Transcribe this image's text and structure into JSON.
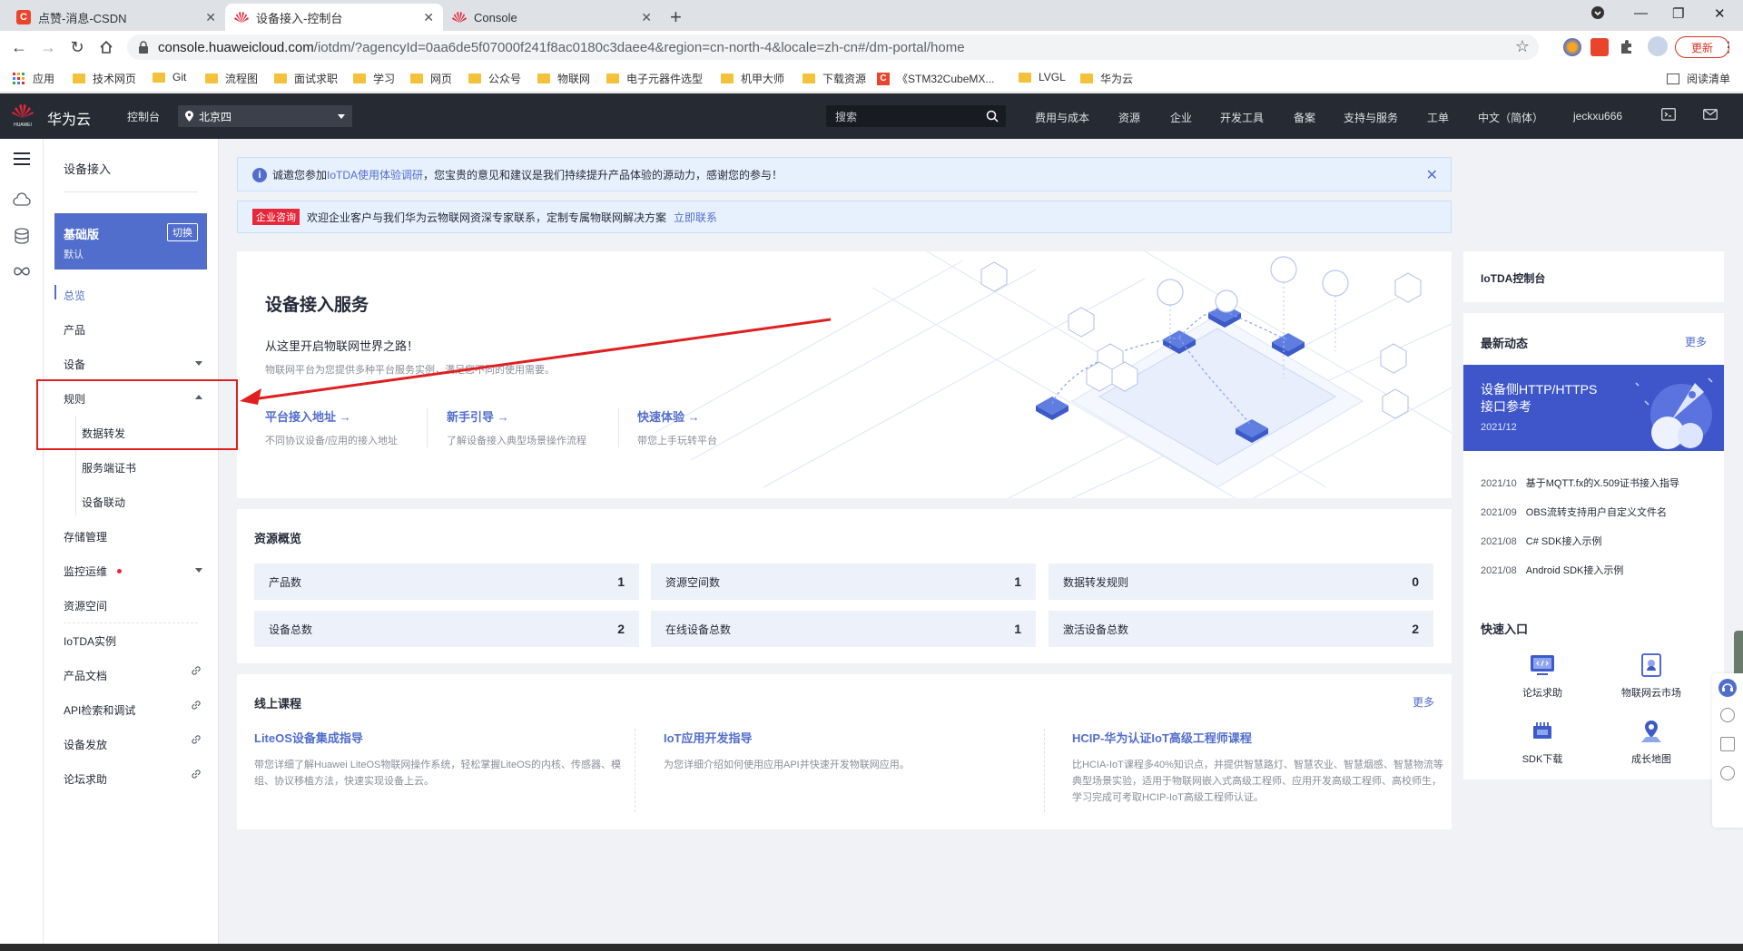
{
  "browser": {
    "tabs": [
      {
        "title": "点赞-消息-CSDN",
        "icon": "csdn-icon",
        "active": false
      },
      {
        "title": "设备接入-控制台",
        "icon": "huawei-icon",
        "active": true
      },
      {
        "title": "Console",
        "icon": "huawei-icon",
        "active": false
      }
    ],
    "url_host": "console.huaweicloud.com",
    "url_path": "/iotdm/?agencyId=0aa6de5f07000f241f8ac0180c3daee4&region=cn-north-4&locale=zh-cn#/dm-portal/home",
    "update_label": "更新",
    "bookmarks": [
      "应用",
      "技术网页",
      "Git",
      "流程图",
      "面试求职",
      "学习",
      "网页",
      "公众号",
      "物联网",
      "电子元器件选型",
      "机甲大师",
      "下载资源",
      "《STM32CubeMX...",
      "LVGL",
      "华为云"
    ],
    "reading_list": "阅读清单"
  },
  "header": {
    "brand": "华为云",
    "logo_text": "HUAWEI",
    "console": "控制台",
    "region": "北京四",
    "search_placeholder": "搜索",
    "nav": [
      "费用与成本",
      "资源",
      "企业",
      "开发工具",
      "备案",
      "支持与服务",
      "工单",
      "中文（简体）",
      "jeckxu666"
    ]
  },
  "side": {
    "title": "设备接入",
    "version_name": "基础版",
    "version_sub": "默认",
    "switch_label": "切换",
    "items": {
      "overview": "总览",
      "product": "产品",
      "device": "设备",
      "rules": "规则",
      "data_forwarding": "数据转发",
      "certificates": "服务端证书",
      "linkage": "设备联动",
      "storage": "存储管理",
      "monitor": "监控运维",
      "resource_space": "资源空间",
      "instance": "IoTDA实例",
      "docs": "产品文档",
      "api": "API检索和调试",
      "provision": "设备发放",
      "forum": "论坛求助"
    }
  },
  "notice": {
    "prefix": "诚邀您参加",
    "link": "IoTDA使用体验调研",
    "suffix": "，您宝贵的意见和建议是我们持续提升产品体验的源动力，感谢您的参与！"
  },
  "enterprise": {
    "tag": "企业咨询",
    "text": "欢迎企业客户与我们华为云物联网资深专家联系，定制专属物联网解决方案",
    "contact": "立即联系"
  },
  "hero": {
    "title": "设备接入服务",
    "subtitle": "从这里开启物联网世界之路！",
    "desc": "物联网平台为您提供多种平台服务实例，满足您不同的使用需要。",
    "links": [
      {
        "title": "平台接入地址 →",
        "desc": "不同协议设备/应用的接入地址"
      },
      {
        "title": "新手引导 →",
        "desc": "了解设备接入典型场景操作流程"
      },
      {
        "title": "快速体验 →",
        "desc": "带您上手玩转平台"
      }
    ]
  },
  "resources": {
    "title": "资源概览",
    "cells": [
      {
        "label": "产品数",
        "value": "1"
      },
      {
        "label": "资源空间数",
        "value": "1"
      },
      {
        "label": "数据转发规则",
        "value": "0"
      },
      {
        "label": "设备总数",
        "value": "2"
      },
      {
        "label": "在线设备总数",
        "value": "1"
      },
      {
        "label": "激活设备总数",
        "value": "2"
      }
    ]
  },
  "courses": {
    "title": "线上课程",
    "more": "更多",
    "items": [
      {
        "title": "LiteOS设备集成指导",
        "desc": "带您详细了解Huawei LiteOS物联网操作系统，轻松掌握LiteOS的内核、传感器、模组、协议移植方法，快速实现设备上云。"
      },
      {
        "title": "IoT应用开发指导",
        "desc": "为您详细介绍如何使用应用API并快速开发物联网应用。"
      },
      {
        "title": "HCIP-华为认证IoT高级工程师课程",
        "desc": "比HCIA-IoT课程多40%知识点，并提供智慧路灯、智慧农业、智慧烟感、智慧物流等典型场景实验，适用于物联网嵌入式高级工程师、应用开发高级工程师、高校师生，学习完成可考取HCIP-IoT高级工程师认证。"
      }
    ]
  },
  "right": {
    "console_title": "IoTDA控制台",
    "news_title": "最新动态",
    "news_more": "更多",
    "banner_title_1": "设备侧HTTP/HTTPS",
    "banner_title_2": "接口参考",
    "banner_date": "2021/12",
    "news": [
      {
        "date": "2021/10",
        "text": "基于MQTT.fx的X.509证书接入指导"
      },
      {
        "date": "2021/09",
        "text": "OBS流转支持用户自定义文件名"
      },
      {
        "date": "2021/08",
        "text": "C# SDK接入示例"
      },
      {
        "date": "2021/08",
        "text": "Android SDK接入示例"
      }
    ],
    "quick_title": "快速入口",
    "quick": [
      "论坛求助",
      "物联网云市场",
      "SDK下载",
      "成长地图"
    ]
  },
  "colors": {
    "accent": "#526ecc",
    "header_bg": "#252a33",
    "annotation": "#e02020"
  }
}
